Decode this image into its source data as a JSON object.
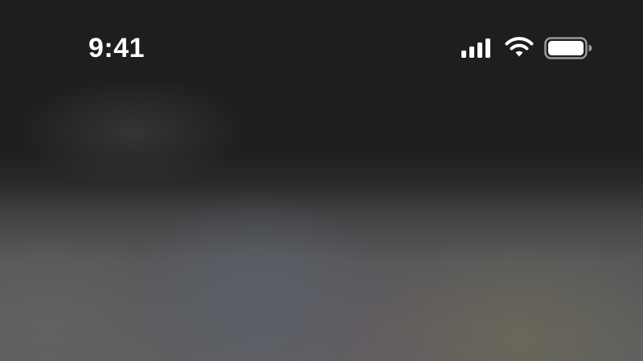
{
  "status_bar": {
    "time": "9:41",
    "icons": {
      "signal": "cellular-signal-icon",
      "wifi": "wifi-icon",
      "battery": "battery-icon"
    },
    "signal_bars_filled": 4,
    "battery_level": 1.0
  },
  "colors": {
    "background_top": "#1e1e1f",
    "background_bottom": "#5f5f61",
    "foreground": "#ffffff"
  }
}
